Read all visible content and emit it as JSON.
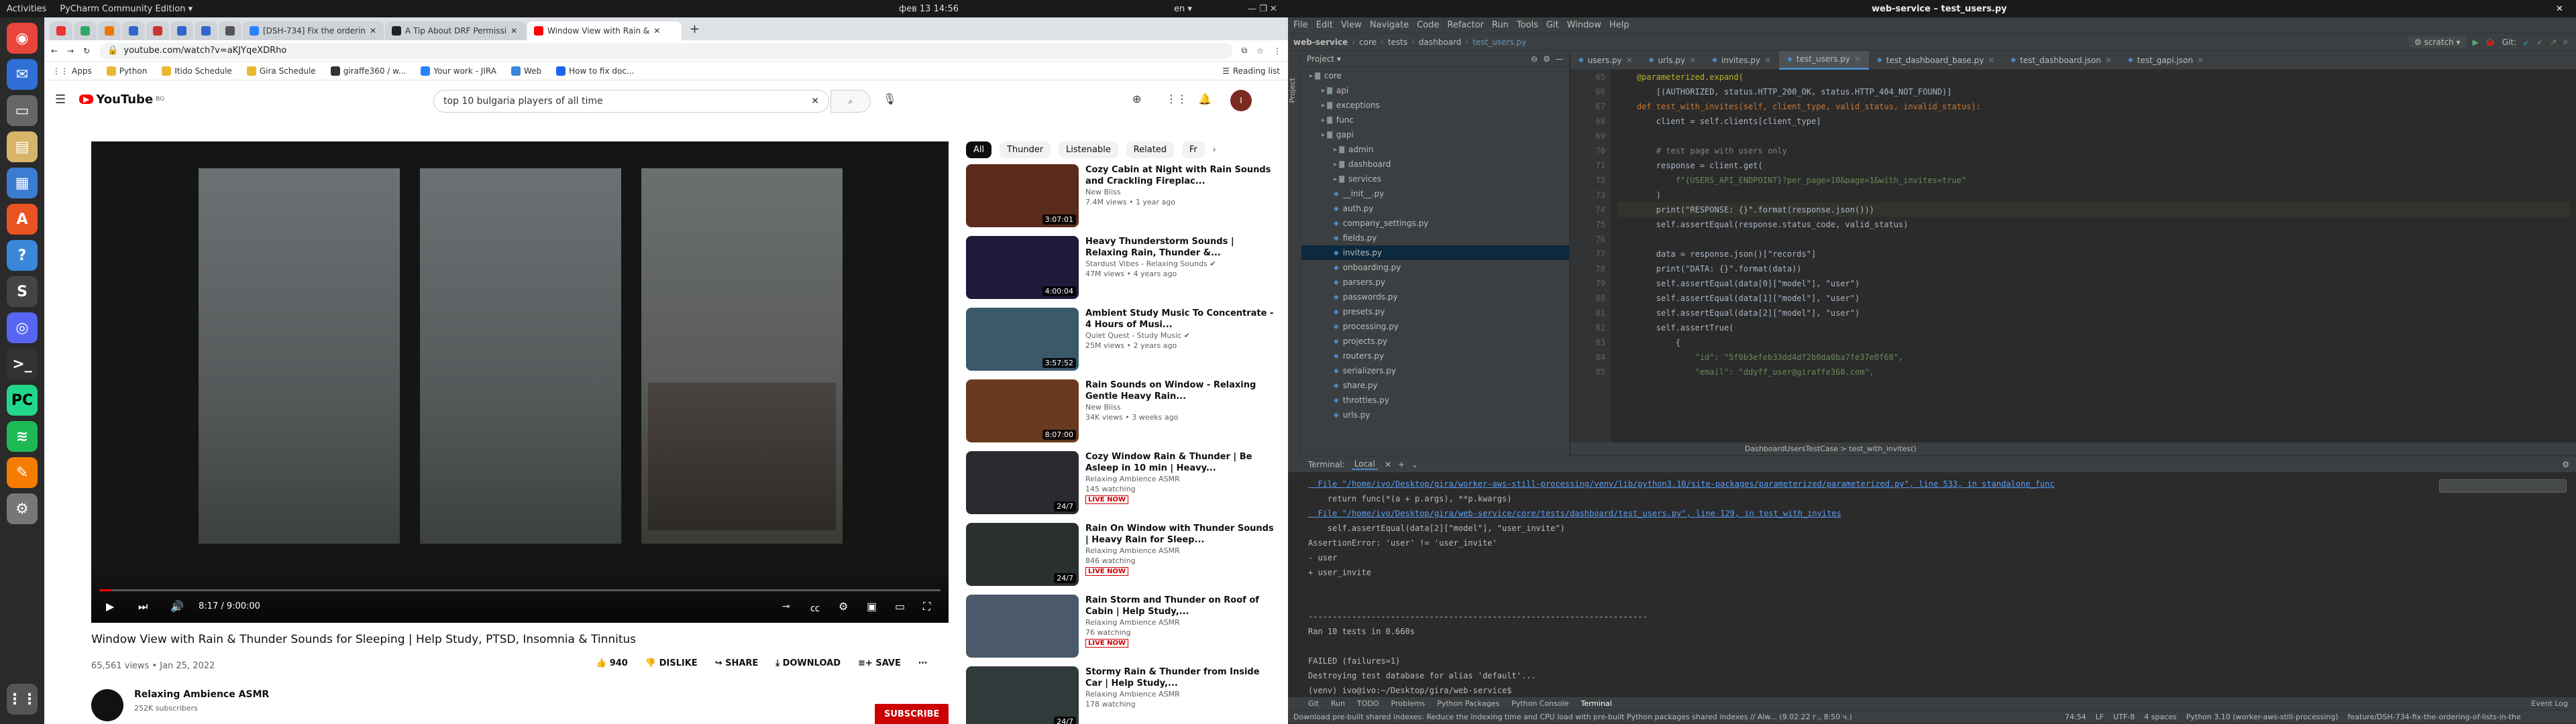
{
  "topbar": {
    "activities": "Activities",
    "app": "PyCharm Community Edition ▾",
    "clock": "фев 13  14:56",
    "lang": "en ▾",
    "window_title": "web-service – test_users.py"
  },
  "browser": {
    "tabs": [
      {
        "label": ""
      },
      {
        "label": ""
      },
      {
        "label": ""
      },
      {
        "label": ""
      },
      {
        "label": ""
      },
      {
        "label": ""
      },
      {
        "label": ""
      },
      {
        "label": ""
      },
      {
        "label": "[DSH-734] Fix the orderin"
      },
      {
        "label": "A Tip About DRF Permissi"
      },
      {
        "label": "Window View with Rain &"
      }
    ],
    "url": "youtube.com/watch?v=aKJYqeXDRho",
    "bookmarks": [
      "Apps",
      "Python",
      "Itido Schedule",
      "Gira Schedule",
      "giraffe360 / w...",
      "Your work - JIRA",
      "Web",
      "How to fix doc..."
    ],
    "reading_list": "Reading list"
  },
  "youtube": {
    "search_value": "top 10 bulgaria  players of all time",
    "video_time": "8:17 / 9:00:00",
    "video_title": "Window View with Rain & Thunder Sounds for Sleeping | Help Study, PTSD, Insomnia & Tinnitus",
    "views_date": "65,561 views • Jan 25, 2022",
    "likes": "940",
    "dislike": "DISLIKE",
    "share": "SHARE",
    "download": "DOWNLOAD",
    "save": "SAVE",
    "channel": "Relaxing Ambience ASMR",
    "subscribers": "252K subscribers",
    "subscribe": "SUBSCRIBE",
    "chips": [
      "All",
      "Thunder",
      "Listenable",
      "Related",
      "Fr"
    ],
    "related": [
      {
        "title": "Cozy Cabin at Night with Rain Sounds and Crackling Fireplac...",
        "channel": "New Bliss",
        "meta": "7.4M views • 1 year ago",
        "duration": "3:07:01",
        "live": "",
        "color": "#5a2a1a"
      },
      {
        "title": "Heavy Thunderstorm Sounds | Relaxing Rain, Thunder &...",
        "channel": "Stardust Vibes - Relaxing Sounds ✔",
        "meta": "47M views • 4 years ago",
        "duration": "4:00:04",
        "live": "",
        "color": "#1d1a3a"
      },
      {
        "title": "Ambient Study Music To Concentrate - 4 Hours of Musi...",
        "channel": "Quiet Quest - Study Music ✔",
        "meta": "25M views • 2 years ago",
        "duration": "3:57:52",
        "live": "",
        "color": "#3a5a6a"
      },
      {
        "title": "Rain Sounds on Window - Relaxing Gentle Heavy Rain...",
        "channel": "New Bliss",
        "meta": "34K views • 3 weeks ago",
        "duration": "8:07:00",
        "live": "",
        "color": "#6a3a20"
      },
      {
        "title": "Cozy Window Rain & Thunder | Be Asleep in 10 min | Heavy...",
        "channel": "Relaxing Ambience ASMR",
        "meta": "145 watching",
        "duration": "24/7",
        "live": "LIVE NOW",
        "color": "#2a2a30"
      },
      {
        "title": "Rain On Window with Thunder Sounds | Heavy Rain for Sleep...",
        "channel": "Relaxing Ambience ASMR",
        "meta": "846 watching",
        "duration": "24/7",
        "live": "LIVE NOW",
        "color": "#2a3030"
      },
      {
        "title": "Rain Storm and Thunder on Roof of Cabin | Help Study,...",
        "channel": "Relaxing Ambience ASMR",
        "meta": "76 watching",
        "duration": "",
        "live": "LIVE NOW",
        "color": "#4a5a6a"
      },
      {
        "title": "Stormy Rain & Thunder from Inside Car | Help Study,...",
        "channel": "Relaxing Ambience ASMR",
        "meta": "178 watching",
        "duration": "24/7",
        "live": "",
        "color": "#303a3a"
      }
    ]
  },
  "ide": {
    "menu": [
      "File",
      "Edit",
      "View",
      "Navigate",
      "Code",
      "Refactor",
      "Run",
      "Tools",
      "Git",
      "Window",
      "Help"
    ],
    "breadcrumb": [
      "web-service",
      "core",
      "tests",
      "dashboard",
      "test_users.py"
    ],
    "run_config": "scratch",
    "git_label": "Git:",
    "project_label": "Project",
    "tree": [
      {
        "name": "core",
        "depth": 0,
        "type": "folder"
      },
      {
        "name": "api",
        "depth": 1,
        "type": "folder"
      },
      {
        "name": "exceptions",
        "depth": 1,
        "type": "folder"
      },
      {
        "name": "func",
        "depth": 1,
        "type": "folder"
      },
      {
        "name": "gapi",
        "depth": 1,
        "type": "folder"
      },
      {
        "name": "admin",
        "depth": 2,
        "type": "folder"
      },
      {
        "name": "dashboard",
        "depth": 2,
        "type": "folder"
      },
      {
        "name": "services",
        "depth": 2,
        "type": "folder"
      },
      {
        "name": "__init__.py",
        "depth": 2,
        "type": "file"
      },
      {
        "name": "auth.py",
        "depth": 2,
        "type": "file"
      },
      {
        "name": "company_settings.py",
        "depth": 2,
        "type": "file"
      },
      {
        "name": "fields.py",
        "depth": 2,
        "type": "file"
      },
      {
        "name": "invites.py",
        "depth": 2,
        "type": "file"
      },
      {
        "name": "onboarding.py",
        "depth": 2,
        "type": "file"
      },
      {
        "name": "parsers.py",
        "depth": 2,
        "type": "file"
      },
      {
        "name": "passwords.py",
        "depth": 2,
        "type": "file"
      },
      {
        "name": "presets.py",
        "depth": 2,
        "type": "file"
      },
      {
        "name": "processing.py",
        "depth": 2,
        "type": "file"
      },
      {
        "name": "projects.py",
        "depth": 2,
        "type": "file"
      },
      {
        "name": "routers.py",
        "depth": 2,
        "type": "file"
      },
      {
        "name": "serializers.py",
        "depth": 2,
        "type": "file"
      },
      {
        "name": "share.py",
        "depth": 2,
        "type": "file"
      },
      {
        "name": "throttles.py",
        "depth": 2,
        "type": "file"
      },
      {
        "name": "urls.py",
        "depth": 2,
        "type": "file"
      }
    ],
    "editor_tabs": [
      "users.py",
      "urls.py",
      "invites.py",
      "test_users.py",
      "test_dashboard_base.py",
      "test_dashboard.json",
      "test_gapi.json"
    ],
    "editor_breadcrumb": "DashboardUsersTestCase  >  test_with_invites()",
    "code": [
      {
        "n": "65",
        "t": "    @parameterized.expand(",
        "c": "dec"
      },
      {
        "n": "66",
        "t": "        [(AUTHORIZED, status.HTTP_200_OK, status.HTTP_404_NOT_FOUND)]",
        "c": ""
      },
      {
        "n": "67",
        "t": "    def test_with_invites(self, client_type, valid_status, invalid_status):",
        "c": "kw"
      },
      {
        "n": "68",
        "t": "        client = self.clients[client_type]",
        "c": ""
      },
      {
        "n": "69",
        "t": "",
        "c": ""
      },
      {
        "n": "70",
        "t": "        # test page with users only",
        "c": "com"
      },
      {
        "n": "71",
        "t": "        response = client.get(",
        "c": ""
      },
      {
        "n": "72",
        "t": "            f\"{USERS_API_ENDPOINT}?per_page=10&page=1&with_invites=true\"",
        "c": "str"
      },
      {
        "n": "73",
        "t": "        )",
        "c": ""
      },
      {
        "n": "74",
        "t": "        print(\"RESPONSE: {}\".format(response.json()))",
        "c": ""
      },
      {
        "n": "75",
        "t": "        self.assertEqual(response.status_code, valid_status)",
        "c": ""
      },
      {
        "n": "76",
        "t": "",
        "c": ""
      },
      {
        "n": "77",
        "t": "        data = response.json()[\"records\"]",
        "c": ""
      },
      {
        "n": "78",
        "t": "        print(\"DATA: {}\".format(data))",
        "c": ""
      },
      {
        "n": "79",
        "t": "        self.assertEqual(data[0][\"model\"], \"user\")",
        "c": ""
      },
      {
        "n": "80",
        "t": "        self.assertEqual(data[1][\"model\"], \"user\")",
        "c": ""
      },
      {
        "n": "81",
        "t": "        self.assertEqual(data[2][\"model\"], \"user\")",
        "c": ""
      },
      {
        "n": "82",
        "t": "        self.assertTrue(",
        "c": ""
      },
      {
        "n": "83",
        "t": "            {",
        "c": ""
      },
      {
        "n": "84",
        "t": "                \"id\": \"5f0b3efeb33dd4df2b0da0ba7fe37e0f68\",",
        "c": "str"
      },
      {
        "n": "85",
        "t": "                \"email\": \"ddyff_user@giraffe360.com\",",
        "c": "str"
      }
    ],
    "terminal_label": "Terminal:",
    "terminal_tab": "Local",
    "terminal": [
      {
        "t": "  File \"/home/ivo/Desktop/gira/worker-aws-still-processing/venv/lib/python3.10/site-packages/parameterized/parameterized.py\", line 533, in standalone_func",
        "k": "link"
      },
      {
        "t": "    return func(*(a + p.args), **p.kwargs)",
        "k": ""
      },
      {
        "t": "  File \"/home/ivo/Desktop/gira/web-service/core/tests/dashboard/test_users.py\", line 129, in test_with_invites",
        "k": "link"
      },
      {
        "t": "    self.assertEqual(data[2][\"model\"], \"user_invite\")",
        "k": ""
      },
      {
        "t": "AssertionError: 'user' != 'user_invite'",
        "k": ""
      },
      {
        "t": "- user",
        "k": ""
      },
      {
        "t": "+ user_invite",
        "k": ""
      },
      {
        "t": "",
        "k": ""
      },
      {
        "t": "",
        "k": ""
      },
      {
        "t": "----------------------------------------------------------------------",
        "k": ""
      },
      {
        "t": "Ran 10 tests in 0.660s",
        "k": ""
      },
      {
        "t": "",
        "k": ""
      },
      {
        "t": "FAILED (failures=1)",
        "k": ""
      },
      {
        "t": "Destroying test database for alias 'default'...",
        "k": ""
      },
      {
        "t": "(venv) ivo@ivo:~/Desktop/gira/web-service$ ",
        "k": "prompt"
      }
    ],
    "bottom_tabs": [
      "Git",
      "Run",
      "TODO",
      "Problems",
      "Python Packages",
      "Python Console",
      "Terminal"
    ],
    "event_log": "Event Log",
    "status_msg": "Download pre-built shared indexes: Reduce the indexing time and CPU load with pre-built Python packages shared indexes // Alw... (9.02.22 г., 8:50 ч.)",
    "status_right": [
      "74:54",
      "LF",
      "UTF-8",
      "4 spaces",
      "Python 3.10 (worker-aws-still-processing)",
      "feature/DSH-734-fix-the-ordering-of-lists-in-the"
    ]
  }
}
